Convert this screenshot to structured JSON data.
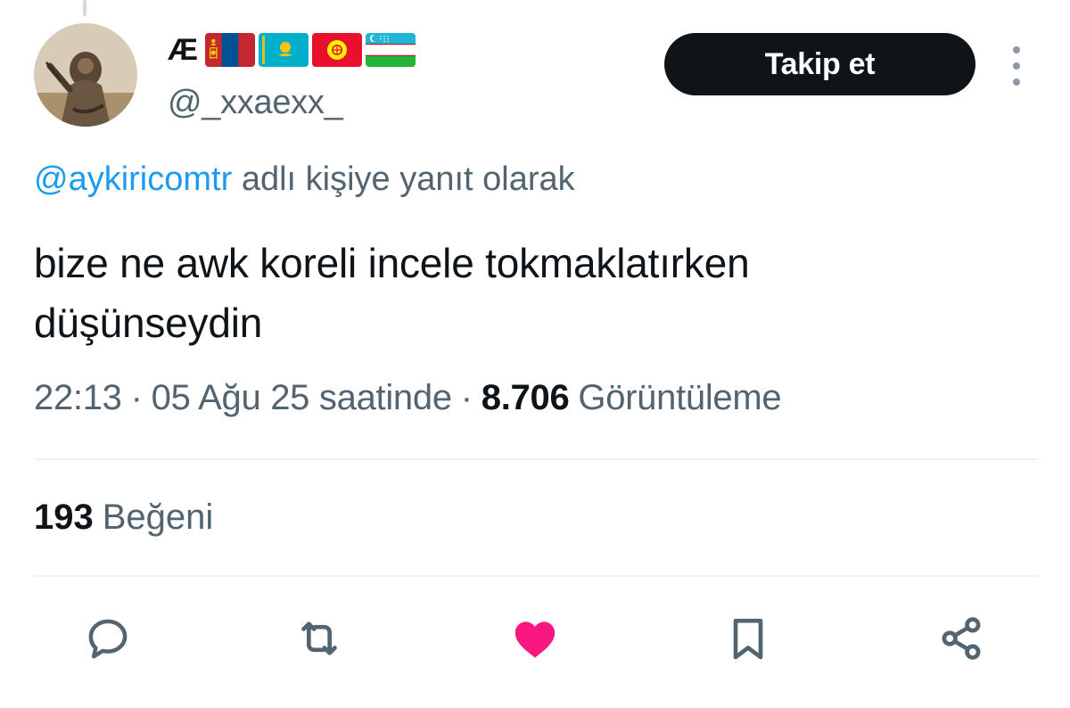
{
  "author": {
    "display_name": "Æ",
    "flags": [
      "mongolia-flag",
      "kazakhstan-flag",
      "kyrgyzstan-flag",
      "uzbekistan-flag"
    ],
    "handle": "@_xxaexx_"
  },
  "header": {
    "follow_label": "Takip et",
    "more_icon": "more-vertical-icon"
  },
  "reply_to": {
    "mention": "@aykiricomtr",
    "suffix": "adlı kişiye yanıt olarak"
  },
  "tweet": {
    "text_line1": "bize ne awk koreli incele tokmaklatırken",
    "text_line2": "düşünseydin"
  },
  "meta": {
    "time": "22:13",
    "date": "05 Ağu 25 saatinde",
    "separator": "·",
    "views_count": "8.706",
    "views_label": "Görüntüleme"
  },
  "stats": {
    "likes_count": "193",
    "likes_label": "Beğeni"
  },
  "actions": [
    {
      "name": "reply",
      "icon": "reply-icon"
    },
    {
      "name": "retweet",
      "icon": "retweet-icon"
    },
    {
      "name": "like",
      "icon": "heart-icon",
      "active": true
    },
    {
      "name": "bookmark",
      "icon": "bookmark-icon"
    },
    {
      "name": "share",
      "icon": "share-icon"
    }
  ],
  "colors": {
    "text_primary": "#0f1419",
    "text_secondary": "#536471",
    "link": "#1d9bf0",
    "like_active": "#f91880",
    "button_bg": "#0f1419",
    "divider": "#eff3f4"
  }
}
